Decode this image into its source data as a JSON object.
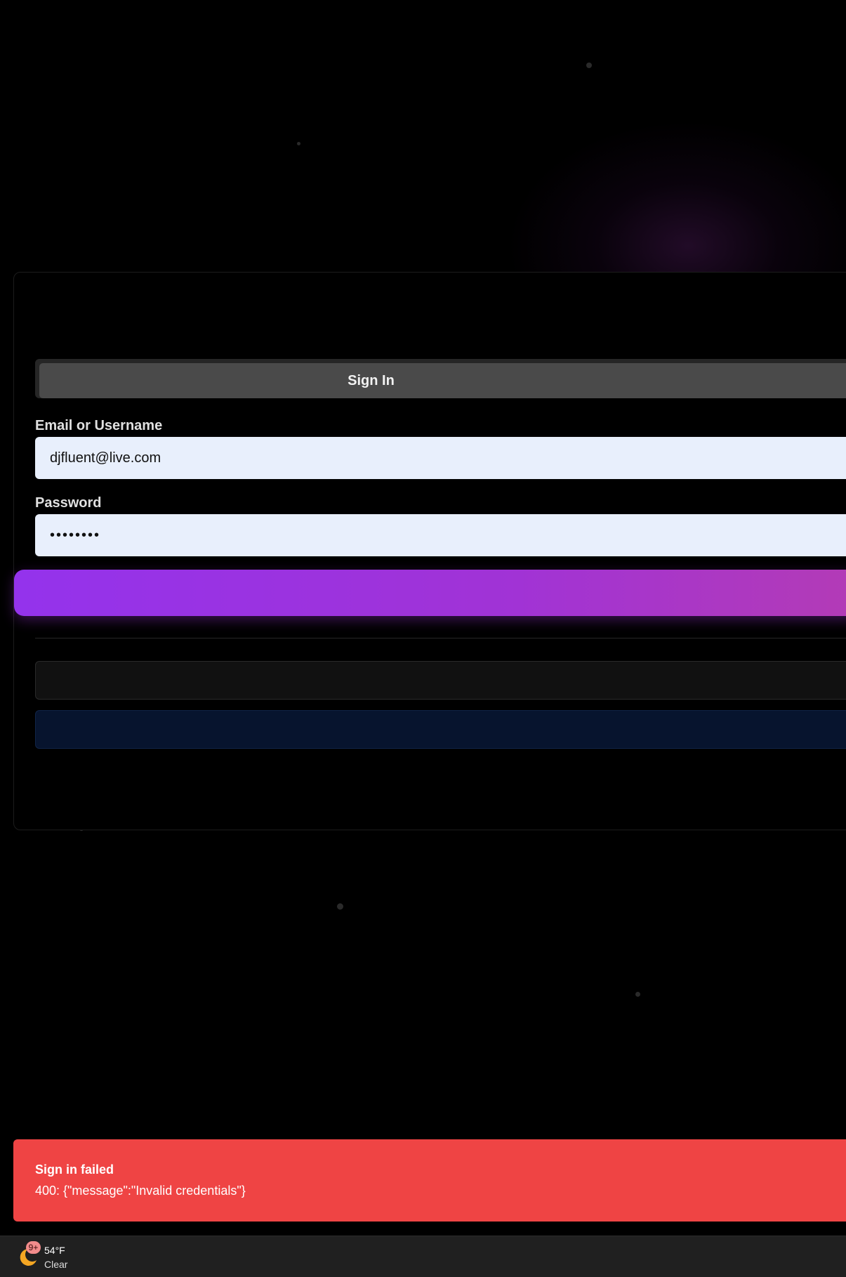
{
  "auth": {
    "tabs": {
      "active_label": "Sign In"
    },
    "email_label": "Email or Username",
    "email_value": "djfluent@live.com",
    "password_label": "Password",
    "password_value": "••••••••"
  },
  "toast": {
    "title": "Sign in failed",
    "message": "400: {\"message\":\"Invalid credentials\"}"
  },
  "taskbar": {
    "badge": "9+",
    "temperature": "54°F",
    "condition": "Clear",
    "weather_icon": "moon-cloud-icon"
  },
  "colors": {
    "background": "#000000",
    "primary_gradient_start": "#9433ec",
    "primary_gradient_end": "#b33bb6",
    "error": "#ef4444",
    "input_bg": "#e8effc"
  }
}
